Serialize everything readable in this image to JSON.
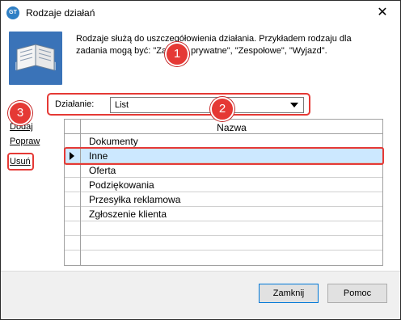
{
  "window": {
    "title": "Rodzaje działań",
    "close_glyph": "✕",
    "app_icon_text": "GT"
  },
  "description": "Rodzaje służą do uszczegółowienia działania. Przykładem rodzaju dla zadania mogą być: \"Zadanie prywatne\", \"Zespołowe\", \"Wyjazd\".",
  "filter": {
    "label": "Działanie:",
    "selected": "List"
  },
  "side_actions": {
    "add": "Dodaj",
    "edit": "Popraw",
    "delete": "Usuń"
  },
  "grid": {
    "column_header": "Nazwa",
    "rows": [
      "Dokumenty",
      "Inne",
      "Oferta",
      "Podziękowania",
      "Przesyłka reklamowa",
      "Zgłoszenie klienta"
    ],
    "selected_row": "Inne"
  },
  "annotations": {
    "one": "1",
    "two": "2",
    "three": "3",
    "color": "#e53935"
  },
  "footer": {
    "close_label": "Zamknij",
    "help_label": "Pomoc"
  },
  "colors": {
    "selection": "#cce8ff",
    "accent": "#0078d7"
  }
}
